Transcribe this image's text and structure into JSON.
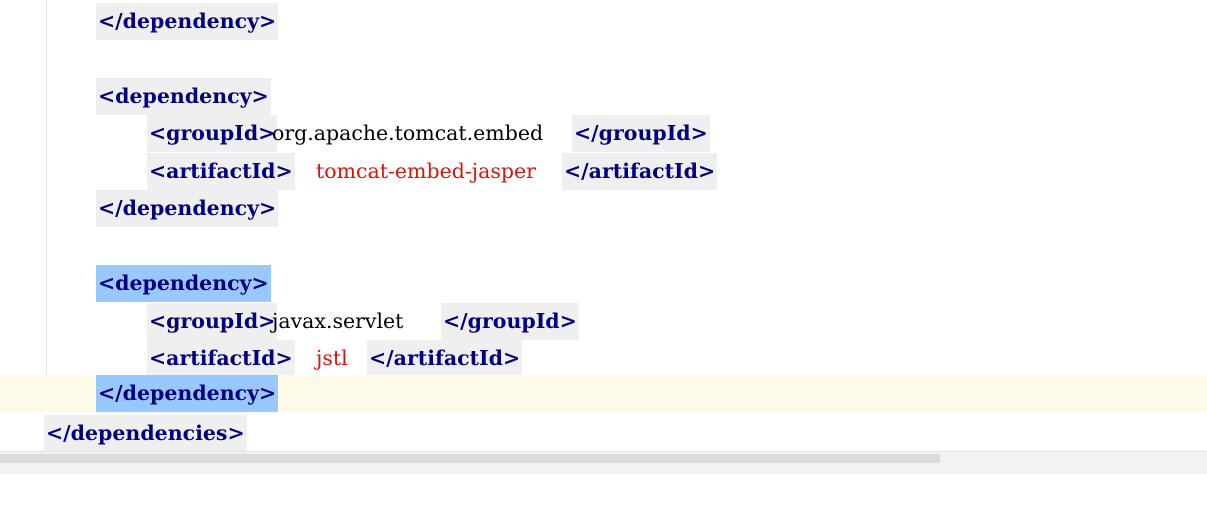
{
  "code": {
    "line1": {
      "close_tag": "</dependency>"
    },
    "line3": {
      "open_tag": "<dependency>"
    },
    "line4": {
      "open_tag": "<groupId>",
      "value": "org.apache.tomcat.embed",
      "close_tag": "</groupId>"
    },
    "line5": {
      "open_tag": "<artifactId>",
      "value": "tomcat-embed-jasper",
      "close_tag": "</artifactId>"
    },
    "line6": {
      "close_tag": "</dependency>"
    },
    "line8": {
      "open_tag": "<dependency>"
    },
    "line9": {
      "open_tag": "<groupId>",
      "value": "javax.servlet",
      "close_tag": "</groupId>"
    },
    "line10": {
      "open_tag": "<artifactId>",
      "value": "jstl",
      "close_tag": "</artifactId>"
    },
    "line11": {
      "close_tag": "</dependency>"
    },
    "line12": {
      "close_tag": "</dependencies>"
    }
  },
  "colors": {
    "tag_name": "#000080",
    "tag_background": "#efefef",
    "matched_tag_highlight": "#99c8ff",
    "caret_line_background": "#fefae8",
    "string_value_red": "#d8150a"
  }
}
